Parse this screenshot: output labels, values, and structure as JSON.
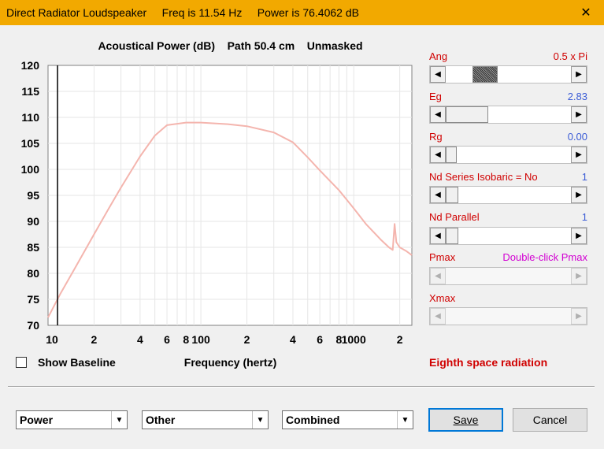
{
  "window": {
    "title": "Direct Radiator Loudspeaker     Freq is 11.54 Hz     Power is 76.4062 dB",
    "close_glyph": "✕"
  },
  "chart_data": {
    "type": "line",
    "title": "Acoustical Power (dB)    Path 50.4 cm    Unmasked",
    "xlabel": "Frequency (hertz)",
    "ylabel": "",
    "xscale": "log",
    "xlim": [
      10,
      2400
    ],
    "ylim": [
      70,
      120
    ],
    "grid": true,
    "yticks": [
      70,
      75,
      80,
      85,
      90,
      95,
      100,
      105,
      110,
      115,
      120
    ],
    "xtick_labels": [
      {
        "x": 10,
        "label": "10"
      },
      {
        "x": 20,
        "label": "2"
      },
      {
        "x": 40,
        "label": "4"
      },
      {
        "x": 60,
        "label": "6"
      },
      {
        "x": 80,
        "label": "8"
      },
      {
        "x": 100,
        "label": "100"
      },
      {
        "x": 200,
        "label": "2"
      },
      {
        "x": 400,
        "label": "4"
      },
      {
        "x": 600,
        "label": "6"
      },
      {
        "x": 800,
        "label": "8"
      },
      {
        "x": 1000,
        "label": "1000"
      },
      {
        "x": 2000,
        "label": "2"
      }
    ],
    "marker_x": 11.54,
    "series": [
      {
        "color": "#f4b5ae",
        "x": [
          10,
          12,
          15,
          20,
          25,
          30,
          40,
          50,
          60,
          80,
          100,
          150,
          200,
          300,
          400,
          500,
          600,
          800,
          1000,
          1200,
          1500,
          1700,
          1800,
          1850,
          1900,
          2000,
          2200,
          2400
        ],
        "y": [
          71.5,
          76,
          81,
          87.5,
          92.5,
          96.5,
          102.5,
          106.5,
          108.5,
          109,
          109,
          108.7,
          108.3,
          107.1,
          105.2,
          102.3,
          99.8,
          96,
          92.5,
          89.5,
          86.5,
          85,
          84.5,
          89.5,
          86,
          85,
          84.3,
          83.5
        ]
      }
    ]
  },
  "sliders": [
    {
      "label": "Ang",
      "value": "0.5 x Pi",
      "value_color": "#d00000"
    },
    {
      "label": "Eg",
      "value": "2.83",
      "value_color": "#3a5bd6"
    },
    {
      "label": "Rg",
      "value": "0.00",
      "value_color": "#3a5bd6"
    },
    {
      "label": "Nd Series   Isobaric = No",
      "value": "1",
      "value_color": "#3a5bd6"
    },
    {
      "label": "Nd  Parallel",
      "value": "1",
      "value_color": "#3a5bd6"
    },
    {
      "label": "Pmax",
      "value": "Double-click Pmax",
      "value_color": "#d200d2"
    },
    {
      "label": "Xmax",
      "value": "",
      "value_color": "#3a5bd6"
    }
  ],
  "show_baseline": {
    "label": "Show Baseline",
    "checked": false
  },
  "radiation_label": "Eighth space radiation",
  "dropdowns": [
    {
      "value": "Power"
    },
    {
      "value": "Other"
    },
    {
      "value": "Combined"
    }
  ],
  "buttons": {
    "save": "Save",
    "cancel": "Cancel"
  }
}
